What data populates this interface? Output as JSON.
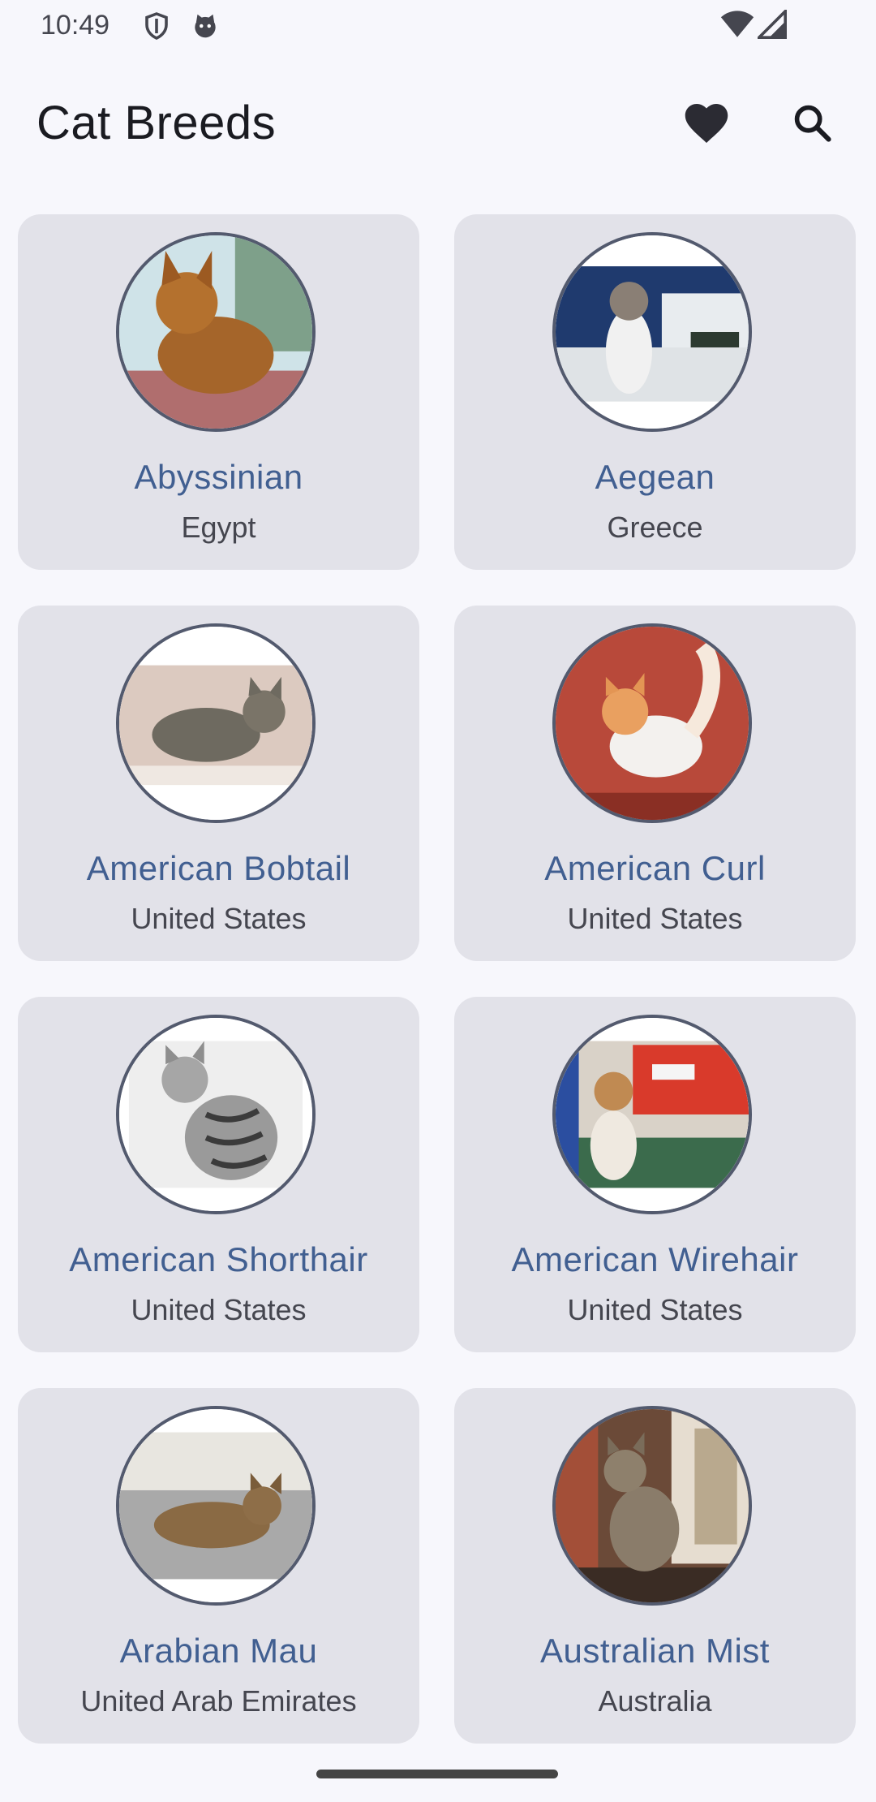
{
  "status_bar": {
    "time": "10:49",
    "icons": [
      "shield-icon",
      "cat-notification-icon"
    ],
    "right_icons": [
      "wifi-icon",
      "signal-icon"
    ]
  },
  "app_bar": {
    "title": "Cat Breeds",
    "actions": [
      "heart-icon",
      "search-icon"
    ]
  },
  "breeds": [
    {
      "name": "Abyssinian",
      "origin": "Egypt"
    },
    {
      "name": "Aegean",
      "origin": "Greece"
    },
    {
      "name": "American Bobtail",
      "origin": "United States"
    },
    {
      "name": "American Curl",
      "origin": "United States"
    },
    {
      "name": "American Shorthair",
      "origin": "United States"
    },
    {
      "name": "American Wirehair",
      "origin": "United States"
    },
    {
      "name": "Arabian Mau",
      "origin": "United Arab Emirates"
    },
    {
      "name": "Australian Mist",
      "origin": "Australia"
    }
  ],
  "colors": {
    "background": "#f7f7fc",
    "card": "#e2e2e9",
    "accent": "#415f91",
    "avatar_border": "#535a6e"
  }
}
